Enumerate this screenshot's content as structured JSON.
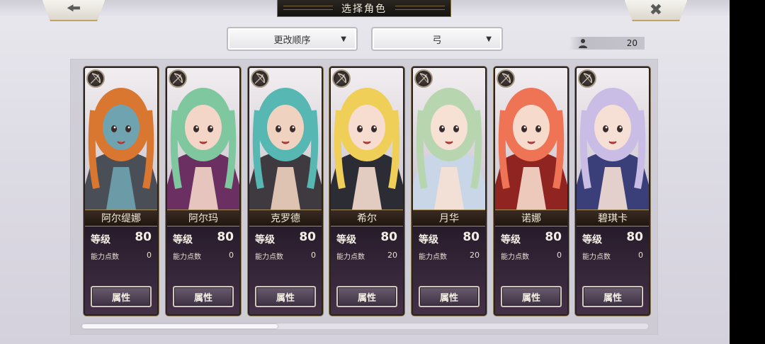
{
  "header": {
    "title": "选择角色",
    "back_icon": "back-arrow-icon",
    "close_icon": "close-x-icon"
  },
  "filters": {
    "sort_label": "更改顺序",
    "weapon_label": "弓"
  },
  "roster": {
    "count": "20"
  },
  "labels": {
    "level": "等级",
    "points": "能力点数",
    "attributes": "属性"
  },
  "characters": [
    {
      "name": "阿尔缇娜",
      "level": "80",
      "points": "0",
      "hair": "#d9762f",
      "skin": "#6fa3b0",
      "outfit": "#4a4f57"
    },
    {
      "name": "阿尔玛",
      "level": "80",
      "points": "0",
      "hair": "#7fc79e",
      "skin": "#f3d6c8",
      "outfit": "#6b2f62"
    },
    {
      "name": "克罗德",
      "level": "80",
      "points": "0",
      "hair": "#56b7b3",
      "skin": "#efd3c0",
      "outfit": "#3f3a40"
    },
    {
      "name": "希尔",
      "level": "80",
      "points": "20",
      "hair": "#f0cf58",
      "skin": "#f6ddd0",
      "outfit": "#2c2c34"
    },
    {
      "name": "月华",
      "level": "80",
      "points": "20",
      "hair": "#b7d6b0",
      "skin": "#f6e1d4",
      "outfit": "#c9d6e8"
    },
    {
      "name": "诺娜",
      "level": "80",
      "points": "0",
      "hair": "#ef7456",
      "skin": "#f6dbcc",
      "outfit": "#8f2420"
    },
    {
      "name": "碧琪卡",
      "level": "80",
      "points": "0",
      "hair": "#c9bde6",
      "skin": "#f6e0d6",
      "outfit": "#3a3f7a"
    }
  ]
}
